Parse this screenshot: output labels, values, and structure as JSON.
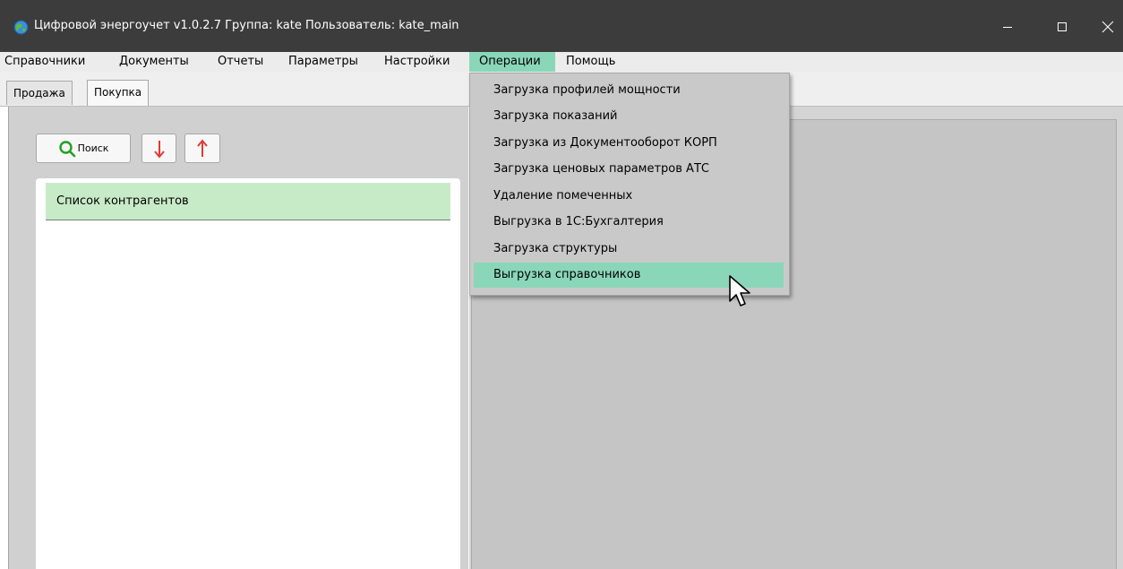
{
  "window": {
    "title": "Цифровой энергоучет v1.0.2.7 Группа: kate Пользователь: kate_main"
  },
  "menubar": {
    "items": [
      "Справочники",
      "Документы",
      "Отчеты",
      "Параметры",
      "Настройки",
      "Операции",
      "Помощь"
    ],
    "active_item": "Операции",
    "active_color": "#8ad6b9"
  },
  "tabs": {
    "items": [
      "Продажа",
      "Покупка"
    ],
    "selected": "Покупка"
  },
  "toolbar": {
    "search_label": "Поиск",
    "down_icon": "arrow-down-icon",
    "up_icon": "arrow-up-icon",
    "arrow_color": "#e03a36",
    "search_icon_color": "#22a022"
  },
  "list": {
    "header": "Список контрагентов",
    "header_color": "#c8ebc7"
  },
  "operations_menu": {
    "items": [
      "Загрузка профилей мощности",
      "Загрузка показаний",
      "Загрузка из Документооборот КОРП",
      "Загрузка ценовых параметров АТС",
      "Удаление помеченных",
      "Выгрузка в 1С:Бухгалтерия",
      "Загрузка структуры",
      "Выгрузка справочников"
    ],
    "highlighted": "Выгрузка справочников"
  }
}
